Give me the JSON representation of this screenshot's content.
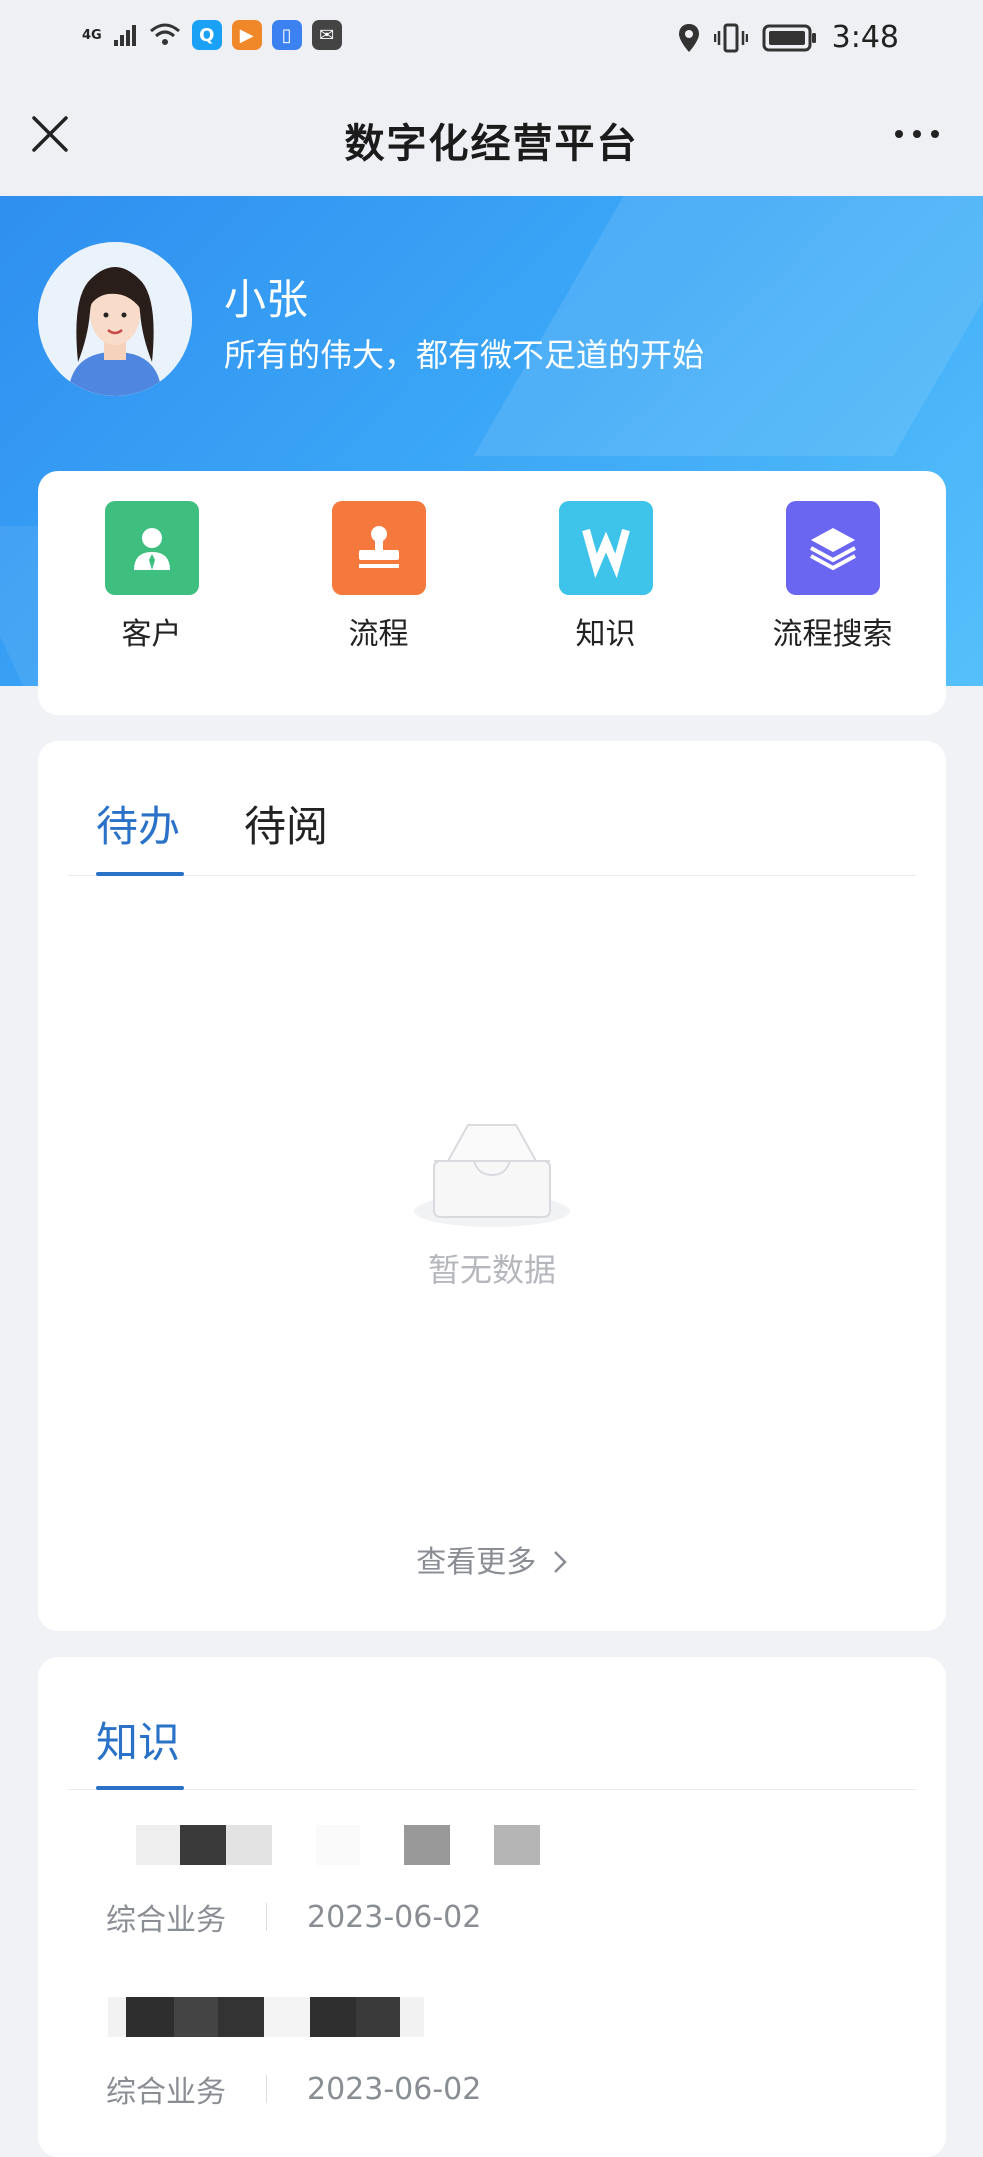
{
  "status_bar": {
    "network": "4G",
    "time": "3:48"
  },
  "navbar": {
    "title": "数字化经营平台"
  },
  "profile": {
    "name": "小张",
    "motto": "所有的伟大，都有微不足道的开始"
  },
  "quick_menu": [
    {
      "label": "客户",
      "icon": "customer-icon",
      "color": "#3fbf7f"
    },
    {
      "label": "流程",
      "icon": "stamp-icon",
      "color": "#f5783d"
    },
    {
      "label": "知识",
      "icon": "w-letter-icon",
      "color": "#3ec3ea"
    },
    {
      "label": "流程搜索",
      "icon": "layers-icon",
      "color": "#6b66f2"
    }
  ],
  "todo": {
    "tabs": [
      "待办",
      "待阅"
    ],
    "active_tab": 0,
    "empty_text": "暂无数据",
    "more_label": "查看更多"
  },
  "knowledge": {
    "title": "知识",
    "articles": [
      {
        "category": "综合业务",
        "date": "2023-06-02"
      },
      {
        "category": "综合业务",
        "date": "2023-06-02"
      }
    ]
  },
  "colors": {
    "accent": "#2a72c8",
    "hero_start": "#2f8ff0",
    "hero_end": "#55c0fb"
  }
}
